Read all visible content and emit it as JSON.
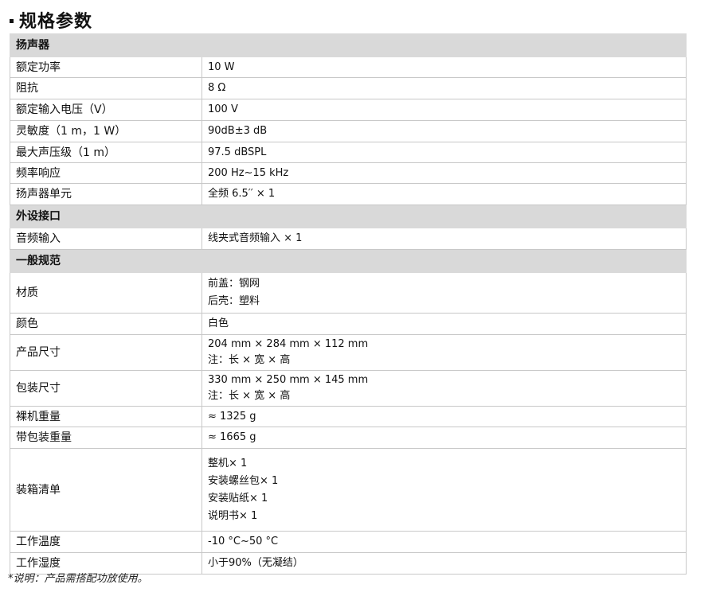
{
  "page": {
    "title": "规格参数",
    "note": "*说明：产品需搭配功放使用。"
  },
  "sections": [
    {
      "name": "扬声器",
      "rows": [
        {
          "label": "额定功率",
          "values": [
            "10 W"
          ]
        },
        {
          "label": "阻抗",
          "values": [
            "8 Ω"
          ]
        },
        {
          "label": "额定输入电压（V）",
          "values": [
            "100 V"
          ]
        },
        {
          "label": "灵敏度（1 m，1 W）",
          "values": [
            "90dB±3 dB"
          ]
        },
        {
          "label": "最大声压级（1 m）",
          "values": [
            "97.5 dBSPL"
          ]
        },
        {
          "label": "频率响应",
          "values": [
            "200 Hz~15 kHz"
          ]
        },
        {
          "label": "扬声器单元",
          "values": [
            "全频  6.5′′ × 1"
          ]
        }
      ]
    },
    {
      "name": "外设接口",
      "rows": [
        {
          "label": "音频输入",
          "values": [
            "线夹式音频输入  × 1"
          ]
        }
      ]
    },
    {
      "name": "一般规范",
      "rows": [
        {
          "label": "材质",
          "values": [
            "前盖：钢网",
            "后壳：塑料"
          ]
        },
        {
          "label": "颜色",
          "values": [
            "白色"
          ]
        },
        {
          "label": "产品尺寸",
          "values": [
            "204 mm × 284 mm × 112 mm",
            "注：长  ×  宽  ×  高"
          ]
        },
        {
          "label": "包装尺寸",
          "values": [
            "330 mm ×    250 mm × 145 mm",
            "注：长  ×  宽  ×  高"
          ]
        },
        {
          "label": "裸机重量",
          "values": [
            "≈ 1325 g"
          ]
        },
        {
          "label": "带包装重量",
          "values": [
            "≈ 1665 g"
          ]
        },
        {
          "label": "装箱清单",
          "values": [
            "整机× 1",
            "安装螺丝包× 1",
            "安装贴纸× 1",
            "说明书× 1"
          ]
        },
        {
          "label": "工作温度",
          "values": [
            "-10 °C~50 °C"
          ]
        },
        {
          "label": "工作湿度",
          "values": [
            "小于90%（无凝结）"
          ]
        }
      ]
    }
  ]
}
